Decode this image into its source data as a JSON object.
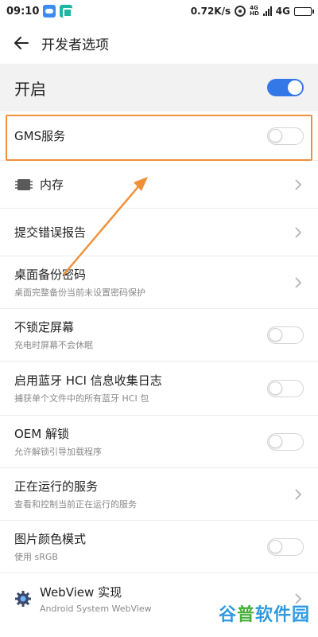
{
  "status_bar": {
    "time": "09:10",
    "speed": "0.72K/s",
    "net_top": "4G",
    "net_bottom": "HD",
    "network": "4G"
  },
  "header": {
    "title": "开发者选项",
    "back_icon": "arrow-left-icon"
  },
  "master_switch": {
    "label": "开启",
    "on": true
  },
  "settings": [
    {
      "id": "gms",
      "title": "GMS服务",
      "subtitle": "",
      "control": "toggle",
      "on": false
    },
    {
      "id": "memory",
      "title": "内存",
      "subtitle": "",
      "control": "chevron",
      "icon": "memory-chip-icon"
    },
    {
      "id": "bug-report",
      "title": "提交错误报告",
      "subtitle": "",
      "control": "chevron"
    },
    {
      "id": "backup-password",
      "title": "桌面备份密码",
      "subtitle": "桌面完整备份当前未设置密码保护",
      "control": "chevron"
    },
    {
      "id": "stay-awake",
      "title": "不锁定屏幕",
      "subtitle": "充电时屏幕不会休眠",
      "control": "toggle",
      "on": false
    },
    {
      "id": "bt-hci-log",
      "title": "启用蓝牙 HCI 信息收集日志",
      "subtitle": "捕获单个文件中的所有蓝牙 HCI 包",
      "control": "toggle",
      "on": false
    },
    {
      "id": "oem-unlock",
      "title": "OEM 解锁",
      "subtitle": "允许解锁引导加载程序",
      "control": "toggle",
      "on": false
    },
    {
      "id": "running-services",
      "title": "正在运行的服务",
      "subtitle": "查看和控制当前正在运行的服务",
      "control": "chevron"
    },
    {
      "id": "color-mode",
      "title": "图片颜色模式",
      "subtitle": "使用 sRGB",
      "control": "toggle",
      "on": false
    },
    {
      "id": "webview",
      "title": "WebView 实现",
      "subtitle": "Android System WebView",
      "control": "chevron",
      "icon": "gear-icon"
    }
  ],
  "watermark": {
    "part_a": "谷",
    "part_b": "普",
    "part_c": "软件园"
  },
  "colors": {
    "accent": "#3478e8",
    "highlight": "#f0913a",
    "master_bg": "#f2f2f2"
  }
}
